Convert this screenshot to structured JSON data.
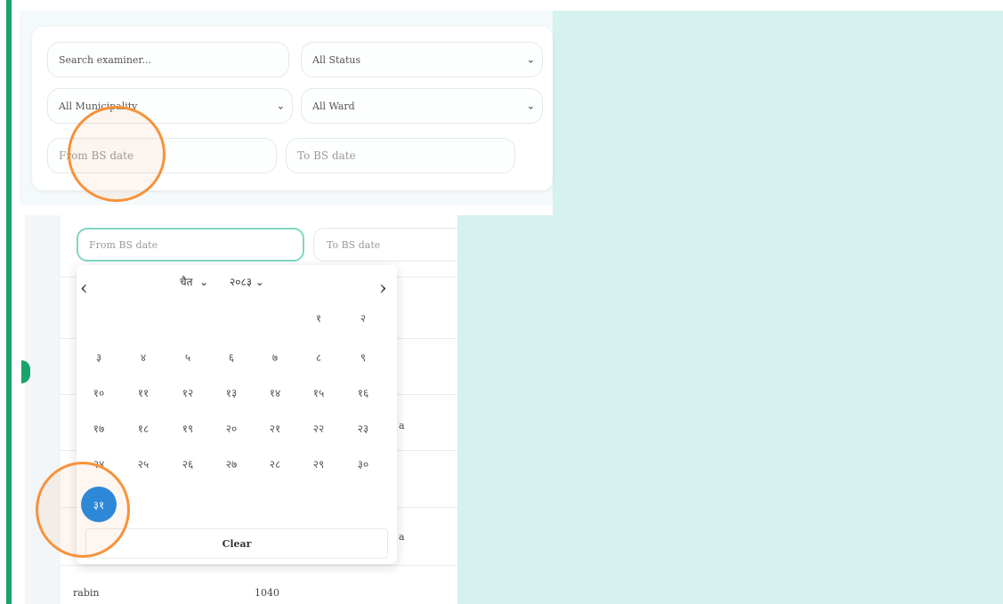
{
  "filters": {
    "search_placeholder": "Search examiner...",
    "status_value": "All Status",
    "municipality_value": "All Municipality",
    "ward_value": "All Ward",
    "from_date_placeholder": "From BS date",
    "to_date_placeholder": "To BS date"
  },
  "datepicker": {
    "month": "चैत",
    "year": "२०८३",
    "prev_icon": "chevron-left-icon",
    "next_icon": "chevron-right-icon",
    "weeks": [
      [
        "",
        "",
        "",
        "",
        "",
        "१",
        "२"
      ],
      [
        "३",
        "४",
        "५",
        "६",
        "७",
        "८",
        "९"
      ],
      [
        "१०",
        "११",
        "१२",
        "१३",
        "१४",
        "१५",
        "१६"
      ],
      [
        "१७",
        "१८",
        "१९",
        "२०",
        "२१",
        "२२",
        "२३"
      ],
      [
        "२४",
        "२५",
        "२६",
        "२७",
        "२८",
        "२९",
        "३०"
      ],
      [
        "३१",
        "",
        "",
        "",
        "",
        "",
        ""
      ]
    ],
    "selected_day": "३१",
    "clear_label": "Clear"
  },
  "background": {
    "row_user": "rabin",
    "row_value": "1040",
    "row_suffix_1": "a",
    "row_suffix_2": "a"
  },
  "colors": {
    "accent": "#17a36b",
    "selected": "#1e88e5",
    "highlight": "#f7923a",
    "panel_bg": "#d6f2ee"
  }
}
